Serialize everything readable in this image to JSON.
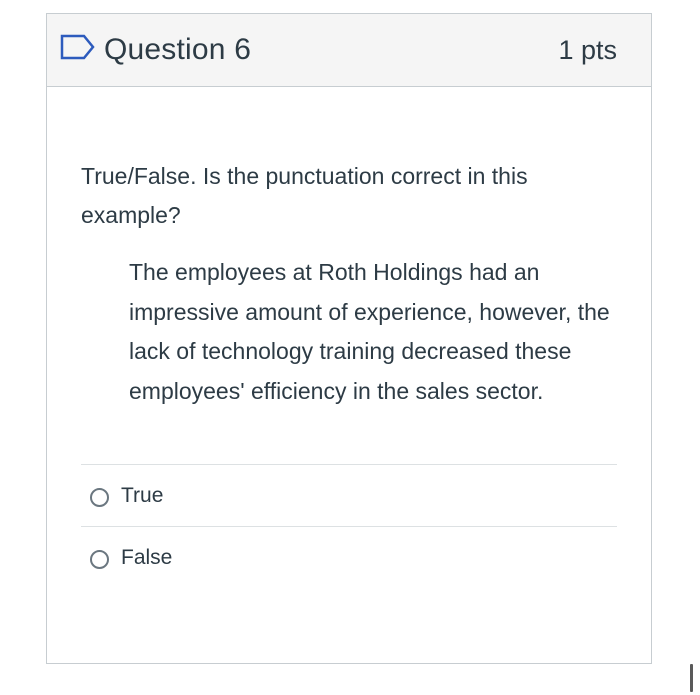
{
  "question": {
    "title": "Question 6",
    "points": "1 pts",
    "flag_icon": "flag-outline-icon",
    "prompt": "True/False. Is the punctuation correct in this example?",
    "example": "The employees at Roth Holdings had an impressive amount of experience, however, the lack of technology training decreased these employees' efficiency in the sales sector.",
    "answers": [
      {
        "label": "True",
        "selected": false
      },
      {
        "label": "False",
        "selected": false
      }
    ]
  },
  "colors": {
    "accent": "#2d5bbd",
    "text": "#2d3b45",
    "border": "#c7cdd1",
    "header_bg": "#f5f5f5"
  }
}
